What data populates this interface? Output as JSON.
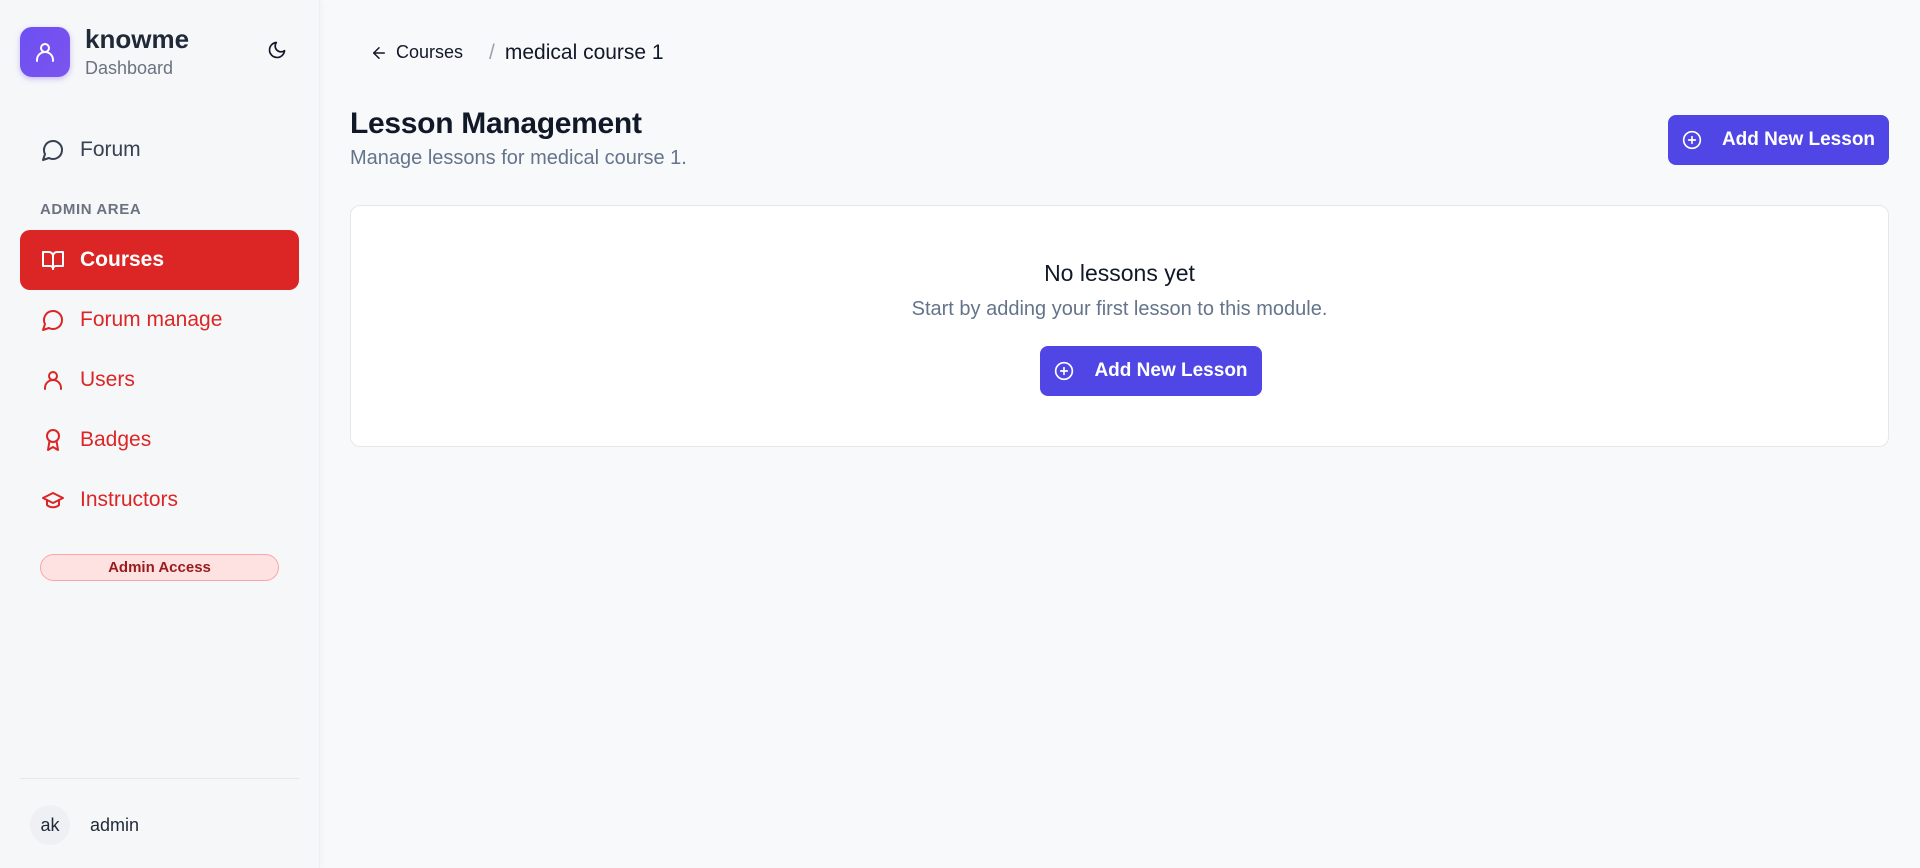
{
  "app": {
    "name": "knowme",
    "subtitle": "Dashboard"
  },
  "sidebar": {
    "forum": {
      "label": "Forum",
      "icon": "chat-bubble-icon"
    },
    "section_label": "ADMIN AREA",
    "admin_items": [
      {
        "label": "Courses",
        "icon": "book-open-icon",
        "active": true
      },
      {
        "label": "Forum manage",
        "icon": "chat-bubble-icon",
        "active": false
      },
      {
        "label": "Users",
        "icon": "user-icon",
        "active": false
      },
      {
        "label": "Badges",
        "icon": "award-icon",
        "active": false
      },
      {
        "label": "Instructors",
        "icon": "graduation-cap-icon",
        "active": false
      }
    ],
    "badge": "Admin Access",
    "user": {
      "initials": "ak",
      "name": "admin"
    }
  },
  "breadcrumb": {
    "back_label": "Courses",
    "separator": "/",
    "current": "medical course 1"
  },
  "page": {
    "title": "Lesson Management",
    "subtitle": "Manage lessons for medical course 1.",
    "add_button_label": "Add New Lesson"
  },
  "empty_state": {
    "title": "No lessons yet",
    "description": "Start by adding your first lesson to this module.",
    "button_label": "Add New Lesson"
  },
  "colors": {
    "brand": "#6d4ff2",
    "active_nav": "#dc2626",
    "primary_button": "#4f46e5",
    "admin_badge_bg": "#fee2e2"
  }
}
